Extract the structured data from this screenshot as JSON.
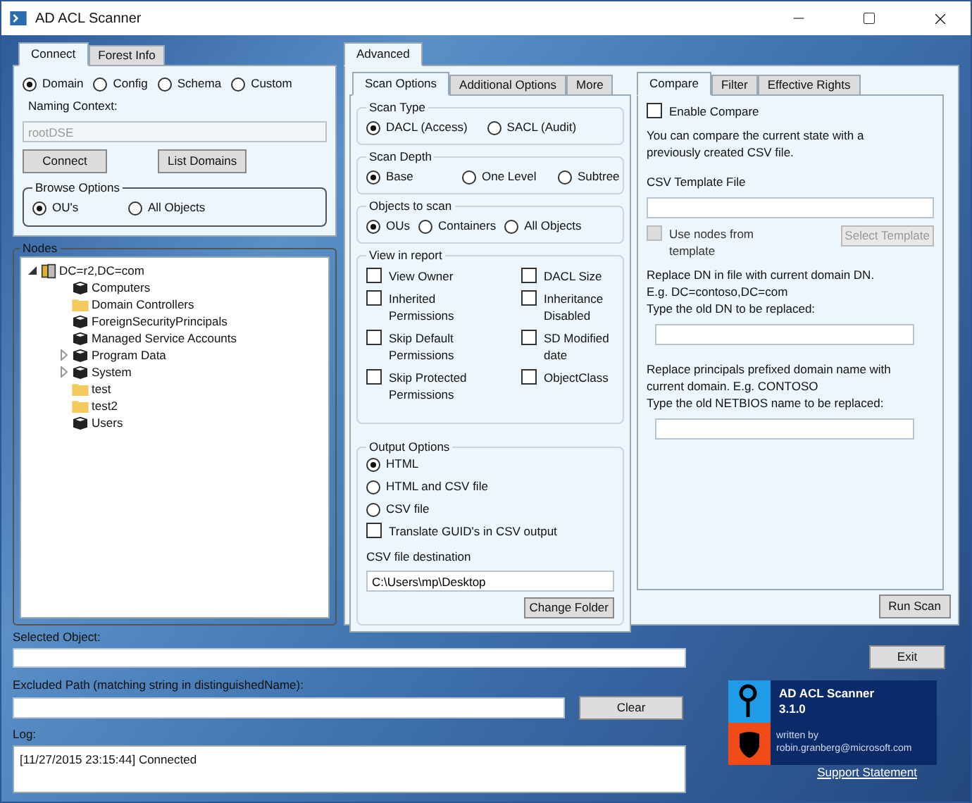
{
  "window": {
    "title": "AD ACL Scanner"
  },
  "connect_tabs": [
    {
      "label": "Connect",
      "selected": true
    },
    {
      "label": "Forest Info",
      "selected": false
    }
  ],
  "context_options": [
    {
      "label": "Domain",
      "selected": true
    },
    {
      "label": "Config",
      "selected": false
    },
    {
      "label": "Schema",
      "selected": false
    },
    {
      "label": "Custom",
      "selected": false
    }
  ],
  "naming_context": {
    "label": "Naming Context:",
    "placeholder": "rootDSE"
  },
  "connect_buttons": [
    "Connect",
    "List Domains"
  ],
  "browse_options": {
    "title": "Browse Options",
    "options": [
      {
        "label": "OU's",
        "selected": true
      },
      {
        "label": "All Objects",
        "selected": false
      }
    ]
  },
  "nodes": {
    "title": "Nodes",
    "tree": [
      {
        "label": "DC=r2,DC=com",
        "kind": "domain",
        "expanded": true,
        "children": [
          {
            "label": "Computers",
            "kind": "container"
          },
          {
            "label": "Domain Controllers",
            "kind": "ou"
          },
          {
            "label": "ForeignSecurityPrincipals",
            "kind": "container"
          },
          {
            "label": "Managed Service Accounts",
            "kind": "container"
          },
          {
            "label": "Program Data",
            "kind": "container",
            "expanded": false
          },
          {
            "label": "System",
            "kind": "container",
            "expanded": false
          },
          {
            "label": "test",
            "kind": "ou"
          },
          {
            "label": "test2",
            "kind": "ou"
          },
          {
            "label": "Users",
            "kind": "container"
          }
        ]
      }
    ]
  },
  "advanced_tabs": [
    {
      "label": "Advanced",
      "selected": true
    }
  ],
  "scan_tabs": [
    {
      "label": "Scan Options",
      "selected": true
    },
    {
      "label": "Additional Options",
      "selected": false
    },
    {
      "label": "More",
      "selected": false
    }
  ],
  "scan_type": {
    "title": "Scan Type",
    "options": [
      {
        "label": "DACL (Access)",
        "selected": true
      },
      {
        "label": "SACL (Audit)",
        "selected": false
      }
    ]
  },
  "scan_depth": {
    "title": "Scan Depth",
    "options": [
      {
        "label": "Base",
        "selected": true
      },
      {
        "label": "One Level",
        "selected": false
      },
      {
        "label": "Subtree",
        "selected": false
      }
    ]
  },
  "objects_to_scan": {
    "title": "Objects to scan",
    "options": [
      {
        "label": "OUs",
        "selected": true
      },
      {
        "label": "Containers",
        "selected": false
      },
      {
        "label": "All Objects",
        "selected": false
      }
    ]
  },
  "view_in_report": {
    "title": "View in report",
    "items": [
      {
        "label": "View Owner",
        "checked": false
      },
      {
        "label": "DACL Size",
        "checked": false
      },
      {
        "label": "Inherited Permissions",
        "checked": false
      },
      {
        "label": "Inheritance Disabled",
        "checked": false
      },
      {
        "label": "Skip Default Permissions",
        "checked": false
      },
      {
        "label": "SD Modified date",
        "checked": false
      },
      {
        "label": "Skip Protected Permissions",
        "checked": false
      },
      {
        "label": "ObjectClass",
        "checked": false
      }
    ]
  },
  "output_options": {
    "title": "Output Options",
    "options": [
      {
        "label": "HTML",
        "selected": true
      },
      {
        "label": "HTML and CSV file",
        "selected": false
      },
      {
        "label": "CSV file",
        "selected": false
      }
    ],
    "translate": {
      "label": "Translate GUID's in CSV output",
      "checked": false
    },
    "destination_label": "CSV file destination",
    "destination_value": "C:\\Users\\mp\\Desktop",
    "button": "Change Folder"
  },
  "compare_tabs": [
    {
      "label": "Compare",
      "selected": true
    },
    {
      "label": "Filter",
      "selected": false
    },
    {
      "label": "Effective Rights",
      "selected": false
    }
  ],
  "compare": {
    "enable": {
      "label": "Enable Compare",
      "checked": false
    },
    "description": "You can compare the current state with a previously created CSV file.",
    "template_label": "CSV Template File",
    "use_nodes": {
      "label": "Use nodes from template",
      "checked": false,
      "disabled": true
    },
    "select_template": {
      "label": "Select Template",
      "disabled": true
    },
    "dn_note": [
      "Replace DN in file with current domain DN.",
      "E.g. DC=contoso,DC=com",
      "Type the old DN to be replaced:"
    ],
    "netbios_note": [
      "Replace principals prefixed domain name with",
      "current domain. E.g. CONTOSO",
      "Type the old NETBIOS name to be replaced:"
    ]
  },
  "run_scan": "Run Scan",
  "selected_object": {
    "label": "Selected Object:"
  },
  "excluded_path": {
    "label": "Excluded Path (matching string in distinguishedName):",
    "button": "Clear"
  },
  "log": {
    "label": "Log:",
    "lines": [
      "[11/27/2015 23:15:44] Connected"
    ]
  },
  "exit": "Exit",
  "about": {
    "name": "AD ACL Scanner",
    "version": "3.1.0",
    "written_by": "written by",
    "email": "robin.granberg@microsoft.com",
    "link": "Support Statement"
  }
}
